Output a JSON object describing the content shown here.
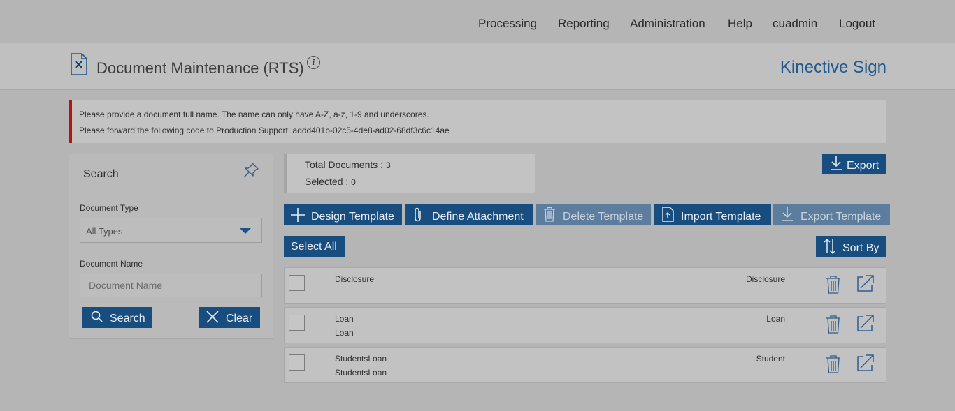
{
  "nav": [
    "Processing",
    "Reporting",
    "Administration",
    "Help",
    "cuadmin",
    "Logout"
  ],
  "header": {
    "title": "Document Maintenance (RTS)",
    "info": "i",
    "brand": "Kinective Sign"
  },
  "alert": {
    "color": "#b01515",
    "line1": "Please provide a document full name. The name can only have A-Z, a-z, 1-9 and underscores.",
    "line2": "Please forward the following code to Production Support: addd401b-02c5-4de8-ad02-68df3c6c14ae"
  },
  "search": {
    "title": "Search",
    "doc_type_label": "Document Type",
    "doc_type_value": "All Types",
    "doc_name_label": "Document Name",
    "doc_name_placeholder": "Document Name",
    "search_label": "Search",
    "clear_label": "Clear"
  },
  "totals": {
    "total_label": "Total Documents :",
    "total_value": "3",
    "selected_label": "Selected :",
    "selected_value": "0"
  },
  "toolbar": {
    "export": "Export",
    "design_template": "Design Template",
    "define_attachment": "Define Attachment",
    "delete_template": "Delete Template",
    "import_template": "Import Template",
    "export_template": "Export Template",
    "select_all": "Select All",
    "sort_by": "Sort By"
  },
  "documents": [
    {
      "name": "Disclosure",
      "subname": "",
      "type": "Disclosure"
    },
    {
      "name": "Loan",
      "subname": "Loan",
      "type": "Loan"
    },
    {
      "name": "StudentsLoan",
      "subname": "StudentsLoan",
      "type": "Student"
    }
  ],
  "colors": {
    "accent": "#184d80",
    "brand": "#1f5a8f",
    "disabled": "#5c7d9e"
  },
  "icons": [
    "document-tools-icon",
    "info-icon",
    "pin-icon",
    "search-icon",
    "close-icon",
    "download-icon",
    "plus-icon",
    "paperclip-icon",
    "trash-icon",
    "upload-file-icon",
    "sort-icon",
    "open-external-icon"
  ]
}
